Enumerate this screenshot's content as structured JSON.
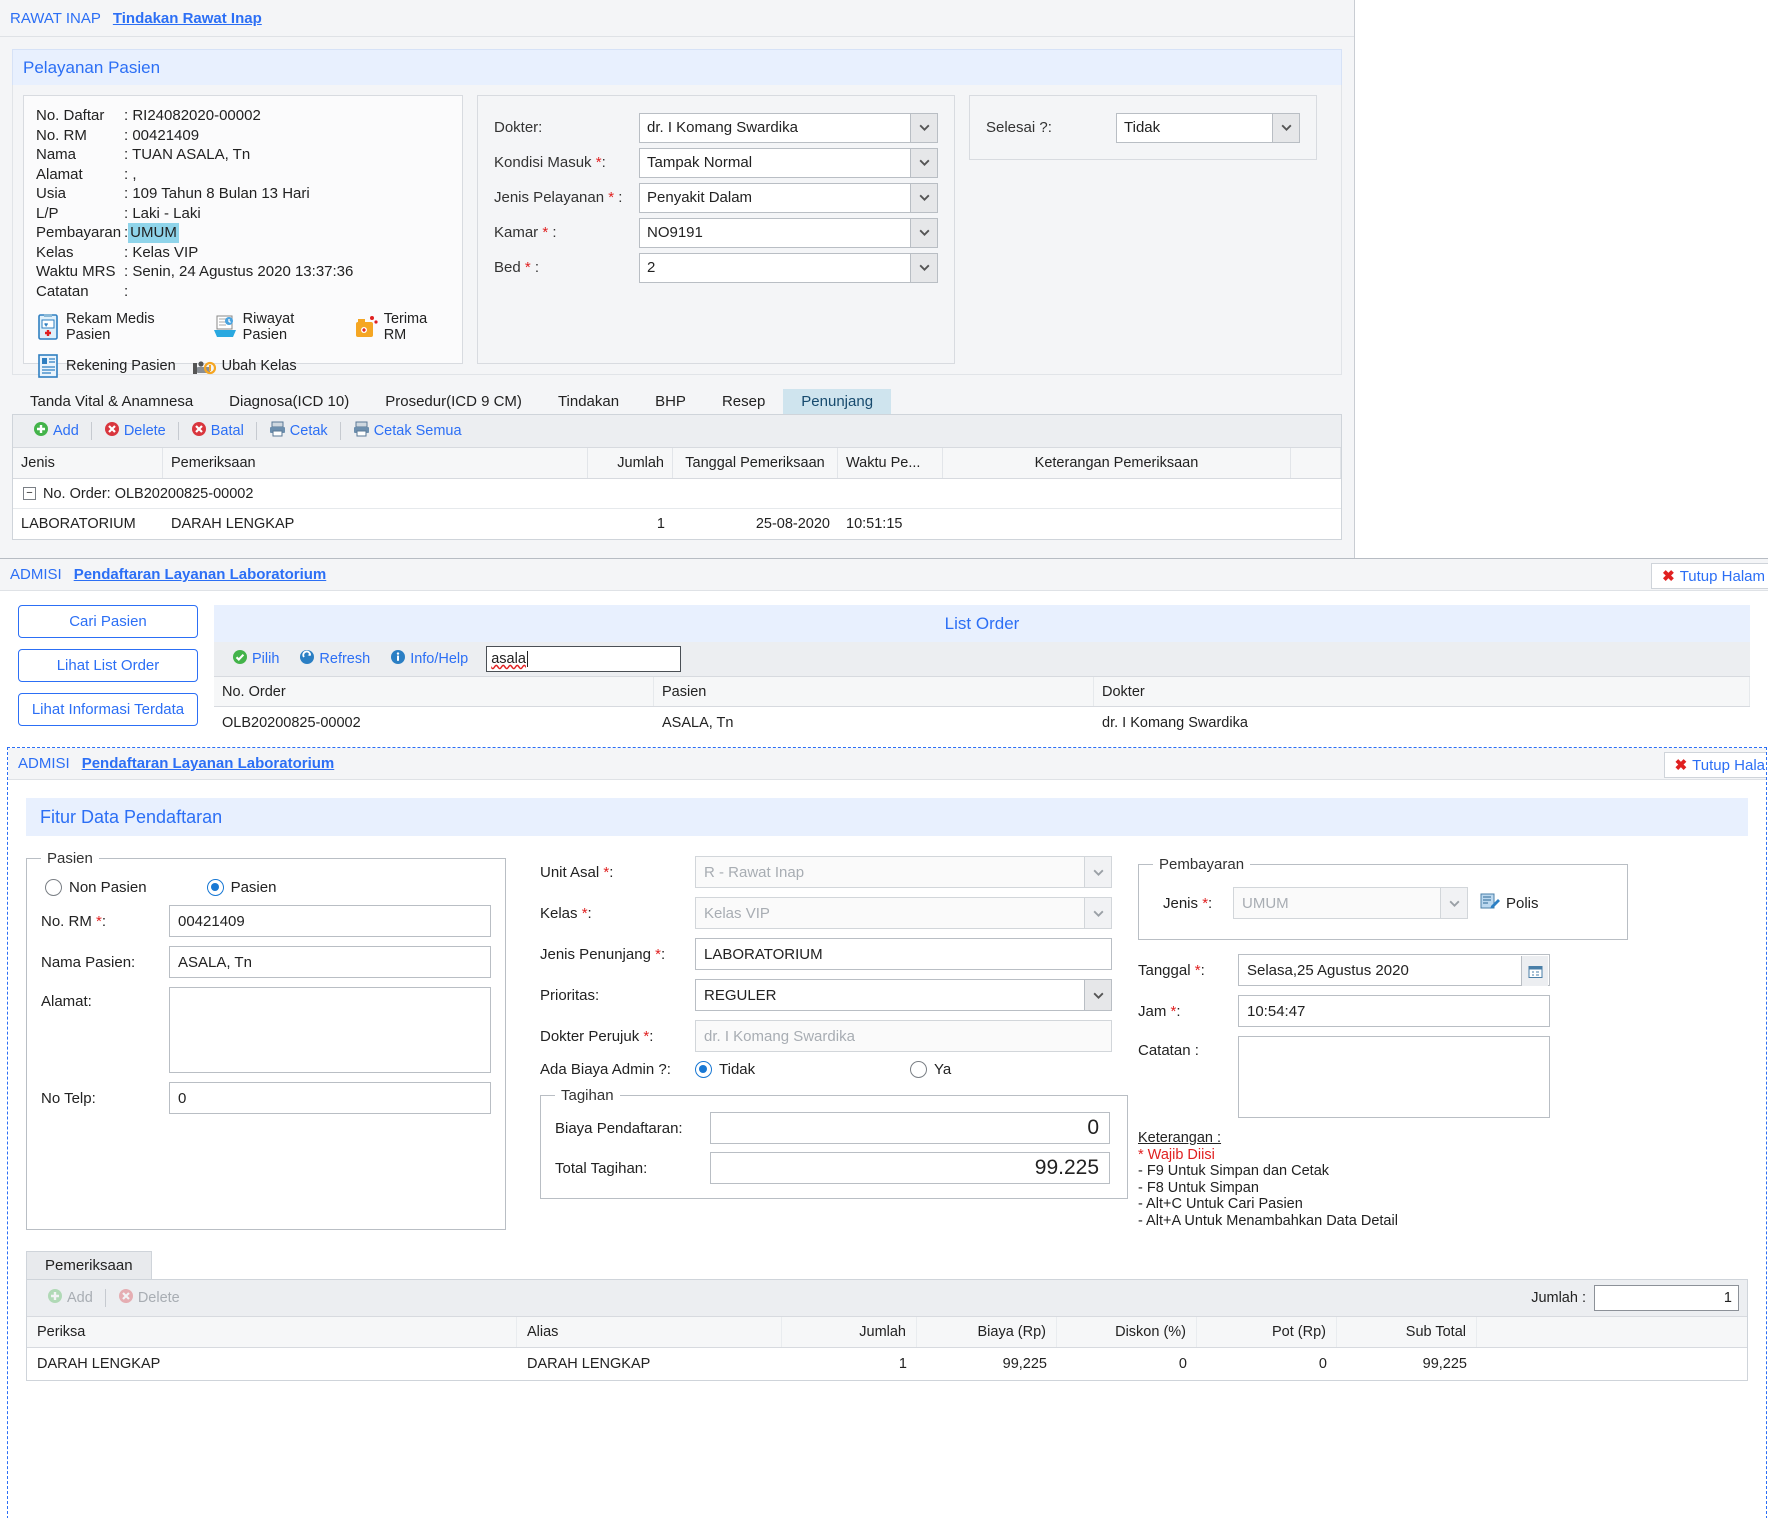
{
  "window1": {
    "breadcrumb_root": "RAWAT INAP",
    "breadcrumb_link": "Tindakan Rawat Inap",
    "panel_title": "Pelayanan Pasien",
    "patient": {
      "rows": [
        {
          "label": "No. Daftar",
          "value": ": RI24082020-00002"
        },
        {
          "label": "No. RM",
          "value": ": 00421409"
        },
        {
          "label": "Nama",
          "value": ": TUAN ASALA, Tn"
        },
        {
          "label": "Alamat",
          "value": ": ,"
        },
        {
          "label": "Usia",
          "value": ": 109 Tahun 8 Bulan 13 Hari"
        },
        {
          "label": "L/P",
          "value": ": Laki - Laki"
        },
        {
          "label": "Pembayaran",
          "value": "UMUM",
          "prefix": ": ",
          "highlight": true
        },
        {
          "label": "Kelas",
          "value": ": Kelas VIP"
        },
        {
          "label": "Waktu MRS",
          "value": ": Senin, 24 Agustus 2020 13:37:36"
        },
        {
          "label": "Catatan",
          "value": ":"
        }
      ],
      "actions": [
        {
          "label": "Rekam Medis Pasien",
          "icon": "medical-record-icon"
        },
        {
          "label": "Riwayat Pasien",
          "icon": "history-icon"
        },
        {
          "label": "Terima RM",
          "icon": "receive-rm-icon"
        },
        {
          "label": "Rekening Pasien",
          "icon": "account-icon"
        },
        {
          "label": "Ubah Kelas",
          "icon": "change-class-icon"
        }
      ]
    },
    "fields": [
      {
        "label": "Dokter:",
        "value": "dr. I Komang Swardika",
        "required": false
      },
      {
        "label": "Kondisi Masuk",
        "value": "Tampak Normal",
        "required": true
      },
      {
        "label": "Jenis Pelayanan",
        "value": "Penyakit Dalam",
        "required": true
      },
      {
        "label": "Kamar",
        "value": "NO9191",
        "required": true
      },
      {
        "label": "Bed",
        "value": "2",
        "required": true
      }
    ],
    "selesai": {
      "label": "Selesai ?:",
      "value": "Tidak"
    },
    "tabs": [
      {
        "label": "Tanda Vital & Anamnesa",
        "active": false
      },
      {
        "label": "Diagnosa(ICD 10)",
        "active": false
      },
      {
        "label": "Prosedur(ICD 9 CM)",
        "active": false
      },
      {
        "label": "Tindakan",
        "active": false
      },
      {
        "label": "BHP",
        "active": false
      },
      {
        "label": "Resep",
        "active": false
      },
      {
        "label": "Penunjang",
        "active": true
      }
    ],
    "grid_tools": [
      {
        "label": "Add",
        "icon": "add-icon"
      },
      {
        "label": "Delete",
        "icon": "delete-icon"
      },
      {
        "label": "Batal",
        "icon": "cancel-icon"
      },
      {
        "label": "Cetak",
        "icon": "print-icon"
      },
      {
        "label": "Cetak Semua",
        "icon": "print-all-icon"
      }
    ],
    "grid_columns": [
      "Jenis",
      "Pemeriksaan",
      "Jumlah",
      "Tanggal Pemeriksaan",
      "Waktu Pe...",
      "Keterangan Pemeriksaan"
    ],
    "group_row": "No. Order: OLB20200825-00002",
    "grid_rows": [
      {
        "jenis": "LABORATORIUM",
        "pemeriksaan": "DARAH LENGKAP",
        "jumlah": "1",
        "tanggal": "25-08-2020",
        "waktu": "10:51:15",
        "keterangan": ""
      }
    ]
  },
  "window2": {
    "breadcrumb_root": "ADMISI",
    "breadcrumb_link": "Pendaftaran Layanan Laboratorium",
    "close_label": "Tutup Halam",
    "buttons": [
      "Cari Pasien",
      "Lihat List Order",
      "Lihat Informasi Terdata"
    ],
    "list_title": "List Order",
    "tools": [
      {
        "label": "Pilih",
        "icon": "check-icon"
      },
      {
        "label": "Refresh",
        "icon": "refresh-icon"
      },
      {
        "label": "Info/Help",
        "icon": "info-icon"
      }
    ],
    "search_value": "asala",
    "columns": [
      "No. Order",
      "Pasien",
      "Dokter"
    ],
    "rows": [
      {
        "no_order": "OLB20200825-00002",
        "pasien": "ASALA, Tn",
        "dokter": "dr. I Komang Swardika"
      }
    ]
  },
  "window3": {
    "breadcrumb_root": "ADMISI",
    "breadcrumb_link": "Pendaftaran Layanan Laboratorium",
    "close_label": "Tutup Hala",
    "panel_title": "Fitur Data Pendaftaran",
    "pasien_group": {
      "legend": "Pasien",
      "radio_non_pasien": "Non Pasien",
      "radio_pasien": "Pasien",
      "selected": "Pasien",
      "no_rm_label": "No. RM",
      "no_rm_value": "00421409",
      "nama_label": "Nama Pasien:",
      "nama_value": "ASALA, Tn",
      "alamat_label": "Alamat:",
      "alamat_value": "",
      "telp_label": "No Telp:",
      "telp_value": "0"
    },
    "mid_fields": [
      {
        "label": "Unit Asal",
        "required": true,
        "value": "R - Rawat Inap",
        "disabled": true,
        "dropdown": true
      },
      {
        "label": "Kelas",
        "required": true,
        "value": "Kelas VIP",
        "disabled": true,
        "dropdown": true
      },
      {
        "label": "Jenis Penunjang",
        "required": true,
        "value": "LABORATORIUM",
        "disabled": false,
        "dropdown": false
      },
      {
        "label": "Prioritas:",
        "required": false,
        "value": "REGULER",
        "disabled": false,
        "dropdown": true
      },
      {
        "label": "Dokter Perujuk",
        "required": true,
        "value": "dr. I Komang Swardika",
        "disabled": true,
        "dropdown": false
      }
    ],
    "biaya_admin": {
      "label": "Ada Biaya Admin ?:",
      "option_no": "Tidak",
      "option_yes": "Ya",
      "selected": "Tidak"
    },
    "tagihan": {
      "legend": "Tagihan",
      "biaya_pendaftaran_label": "Biaya Pendaftaran:",
      "biaya_pendaftaran_value": "0",
      "total_tagihan_label": "Total Tagihan:",
      "total_tagihan_value": "99.225"
    },
    "pembayaran": {
      "legend": "Pembayaran",
      "jenis_label": "Jenis",
      "jenis_value": "UMUM",
      "polis_label": "Polis",
      "tanggal_label": "Tanggal",
      "tanggal_value": "Selasa,25 Agustus 2020",
      "jam_label": "Jam",
      "jam_value": "10:54:47",
      "catatan_label": "Catatan :",
      "catatan_value": ""
    },
    "keterangan": {
      "title": "Keterangan :",
      "star_line": "* Wajib Diisi",
      "lines": [
        "- F9 Untuk Simpan dan Cetak",
        "- F8 Untuk Simpan",
        "- Alt+C Untuk Cari Pasien",
        "- Alt+A Untuk Menambahkan Data Detail"
      ]
    },
    "bottom_tab": "Pemeriksaan",
    "bottom_tools": [
      {
        "label": "Add",
        "icon": "add-icon",
        "disabled": true
      },
      {
        "label": "Delete",
        "icon": "delete-icon",
        "disabled": true
      }
    ],
    "jumlah_label": "Jumlah :",
    "jumlah_value": "1",
    "columns": [
      "Periksa",
      "Alias",
      "Jumlah",
      "Biaya (Rp)",
      "Diskon (%)",
      "Pot (Rp)",
      "Sub Total"
    ],
    "rows": [
      {
        "periksa": "DARAH LENGKAP",
        "alias": "DARAH LENGKAP",
        "jumlah": "1",
        "biaya": "99,225",
        "diskon": "0",
        "pot": "0",
        "subtotal": "99,225"
      }
    ]
  }
}
